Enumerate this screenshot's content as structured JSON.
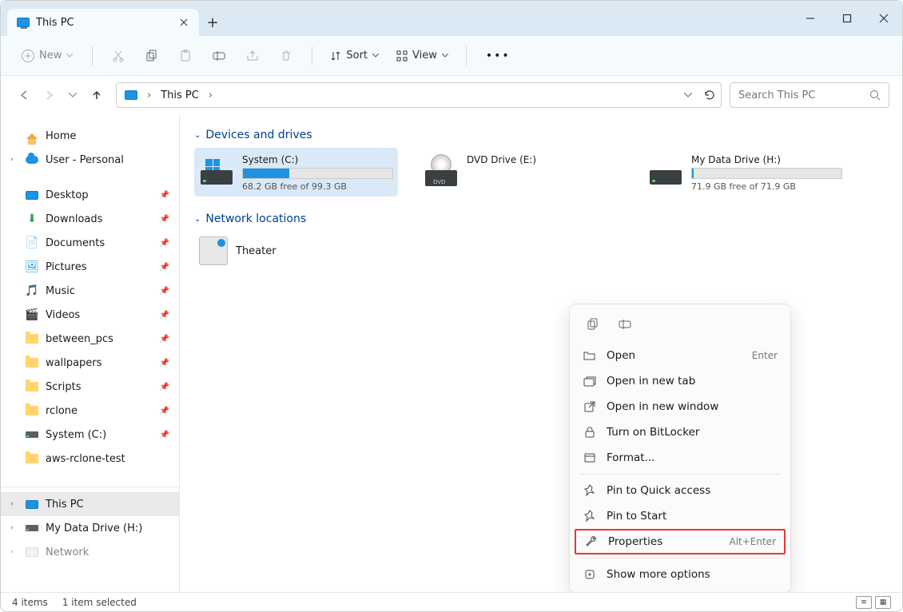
{
  "tab": {
    "title": "This PC"
  },
  "toolbar": {
    "new": "New",
    "sort": "Sort",
    "view": "View"
  },
  "address": {
    "location": "This PC",
    "search_placeholder": "Search This PC"
  },
  "sidebar": {
    "home": "Home",
    "user": "User - Personal",
    "quick": [
      "Desktop",
      "Downloads",
      "Documents",
      "Pictures",
      "Music",
      "Videos",
      "between_pcs",
      "wallpapers",
      "Scripts",
      "rclone",
      "System (C:)",
      "aws-rclone-test"
    ],
    "thispc": "This PC",
    "mydata": "My Data Drive (H:)",
    "network": "Network"
  },
  "sections": {
    "devices": "Devices and drives",
    "network": "Network locations"
  },
  "drives": {
    "system": {
      "name": "System (C:)",
      "free": "68.2 GB free of 99.3 GB",
      "fill_pct": 31
    },
    "dvd": {
      "name": "DVD Drive (E:)"
    },
    "mydata": {
      "name": "My Data Drive (H:)",
      "free": "71.9 GB free of 71.9 GB",
      "fill_pct": 1
    }
  },
  "theater": "Theater",
  "ctx": {
    "open": "Open",
    "open_short": "Enter",
    "open_tab": "Open in new tab",
    "open_window": "Open in new window",
    "bitlocker": "Turn on BitLocker",
    "format": "Format...",
    "pin_quick": "Pin to Quick access",
    "pin_start": "Pin to Start",
    "properties": "Properties",
    "properties_short": "Alt+Enter",
    "more": "Show more options"
  },
  "status": {
    "items": "4 items",
    "selected": "1 item selected"
  }
}
